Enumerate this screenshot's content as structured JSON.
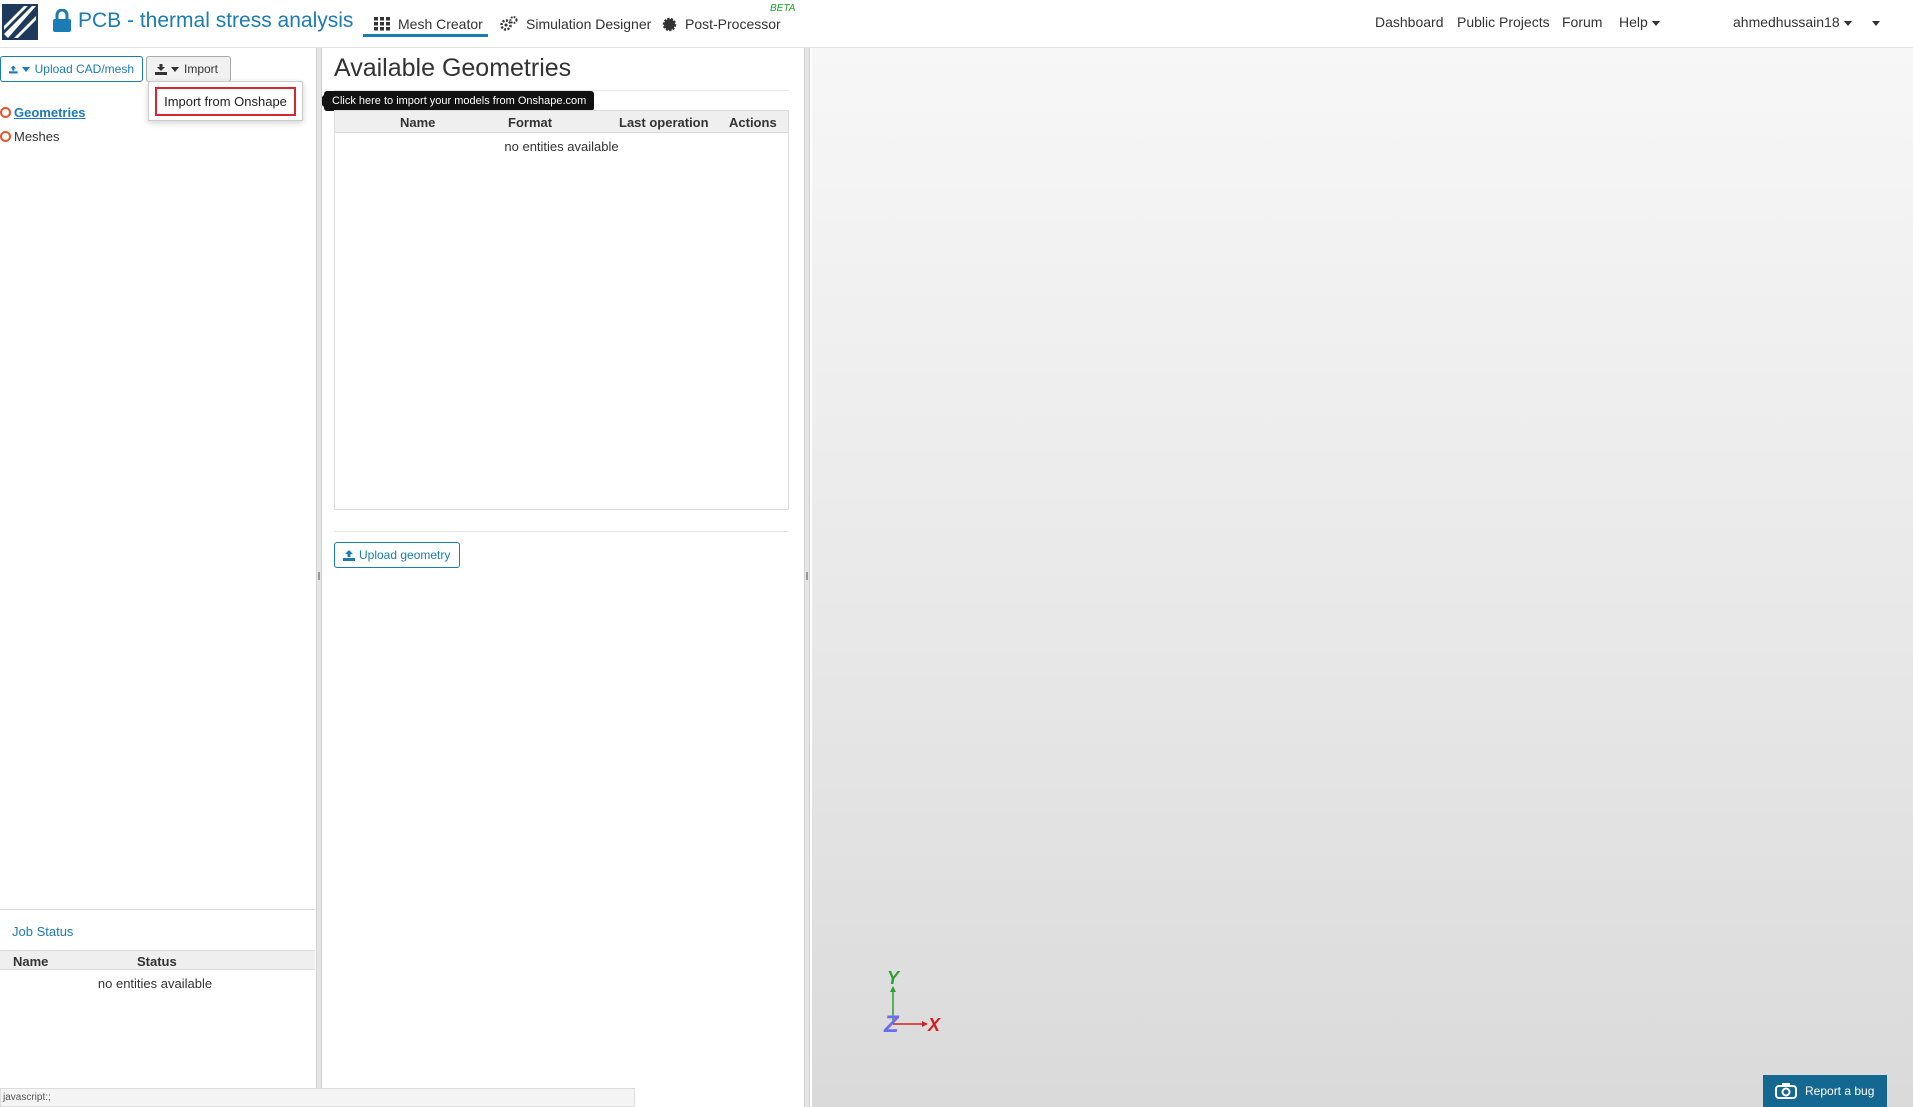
{
  "header": {
    "project_title": "PCB - thermal stress analysis",
    "tabs": [
      {
        "label": "Mesh Creator",
        "icon": "grid-icon",
        "active": true
      },
      {
        "label": "Simulation Designer",
        "icon": "gears-icon"
      },
      {
        "label": "Post-Processor",
        "icon": "gear-icon",
        "badge": "BETA"
      }
    ],
    "links": [
      "Dashboard",
      "Public Projects",
      "Forum",
      "Help"
    ],
    "user": "ahmedhussain18",
    "accent_color": "#1b7bb5"
  },
  "left_panel": {
    "upload_label": "Upload CAD/mesh",
    "import_label": "Import",
    "import_menu": {
      "item": "Import from Onshape",
      "tooltip": "Click here to import your models from Onshape.com"
    },
    "tree": [
      "Geometries",
      "Meshes"
    ],
    "job_status": {
      "title": "Job Status",
      "columns": [
        "Name",
        "Status"
      ],
      "empty_text": "no entities available"
    }
  },
  "main": {
    "title": "Available Geometries",
    "table": {
      "columns": [
        "Name",
        "Format",
        "Last operation",
        "Actions"
      ],
      "empty_text": "no entities available"
    },
    "upload_button": "Upload geometry"
  },
  "viewport": {
    "axes": {
      "x": "X",
      "y": "Y",
      "z": "Z"
    },
    "report_label": "Report a bug"
  },
  "status_bar": "javascript:;"
}
